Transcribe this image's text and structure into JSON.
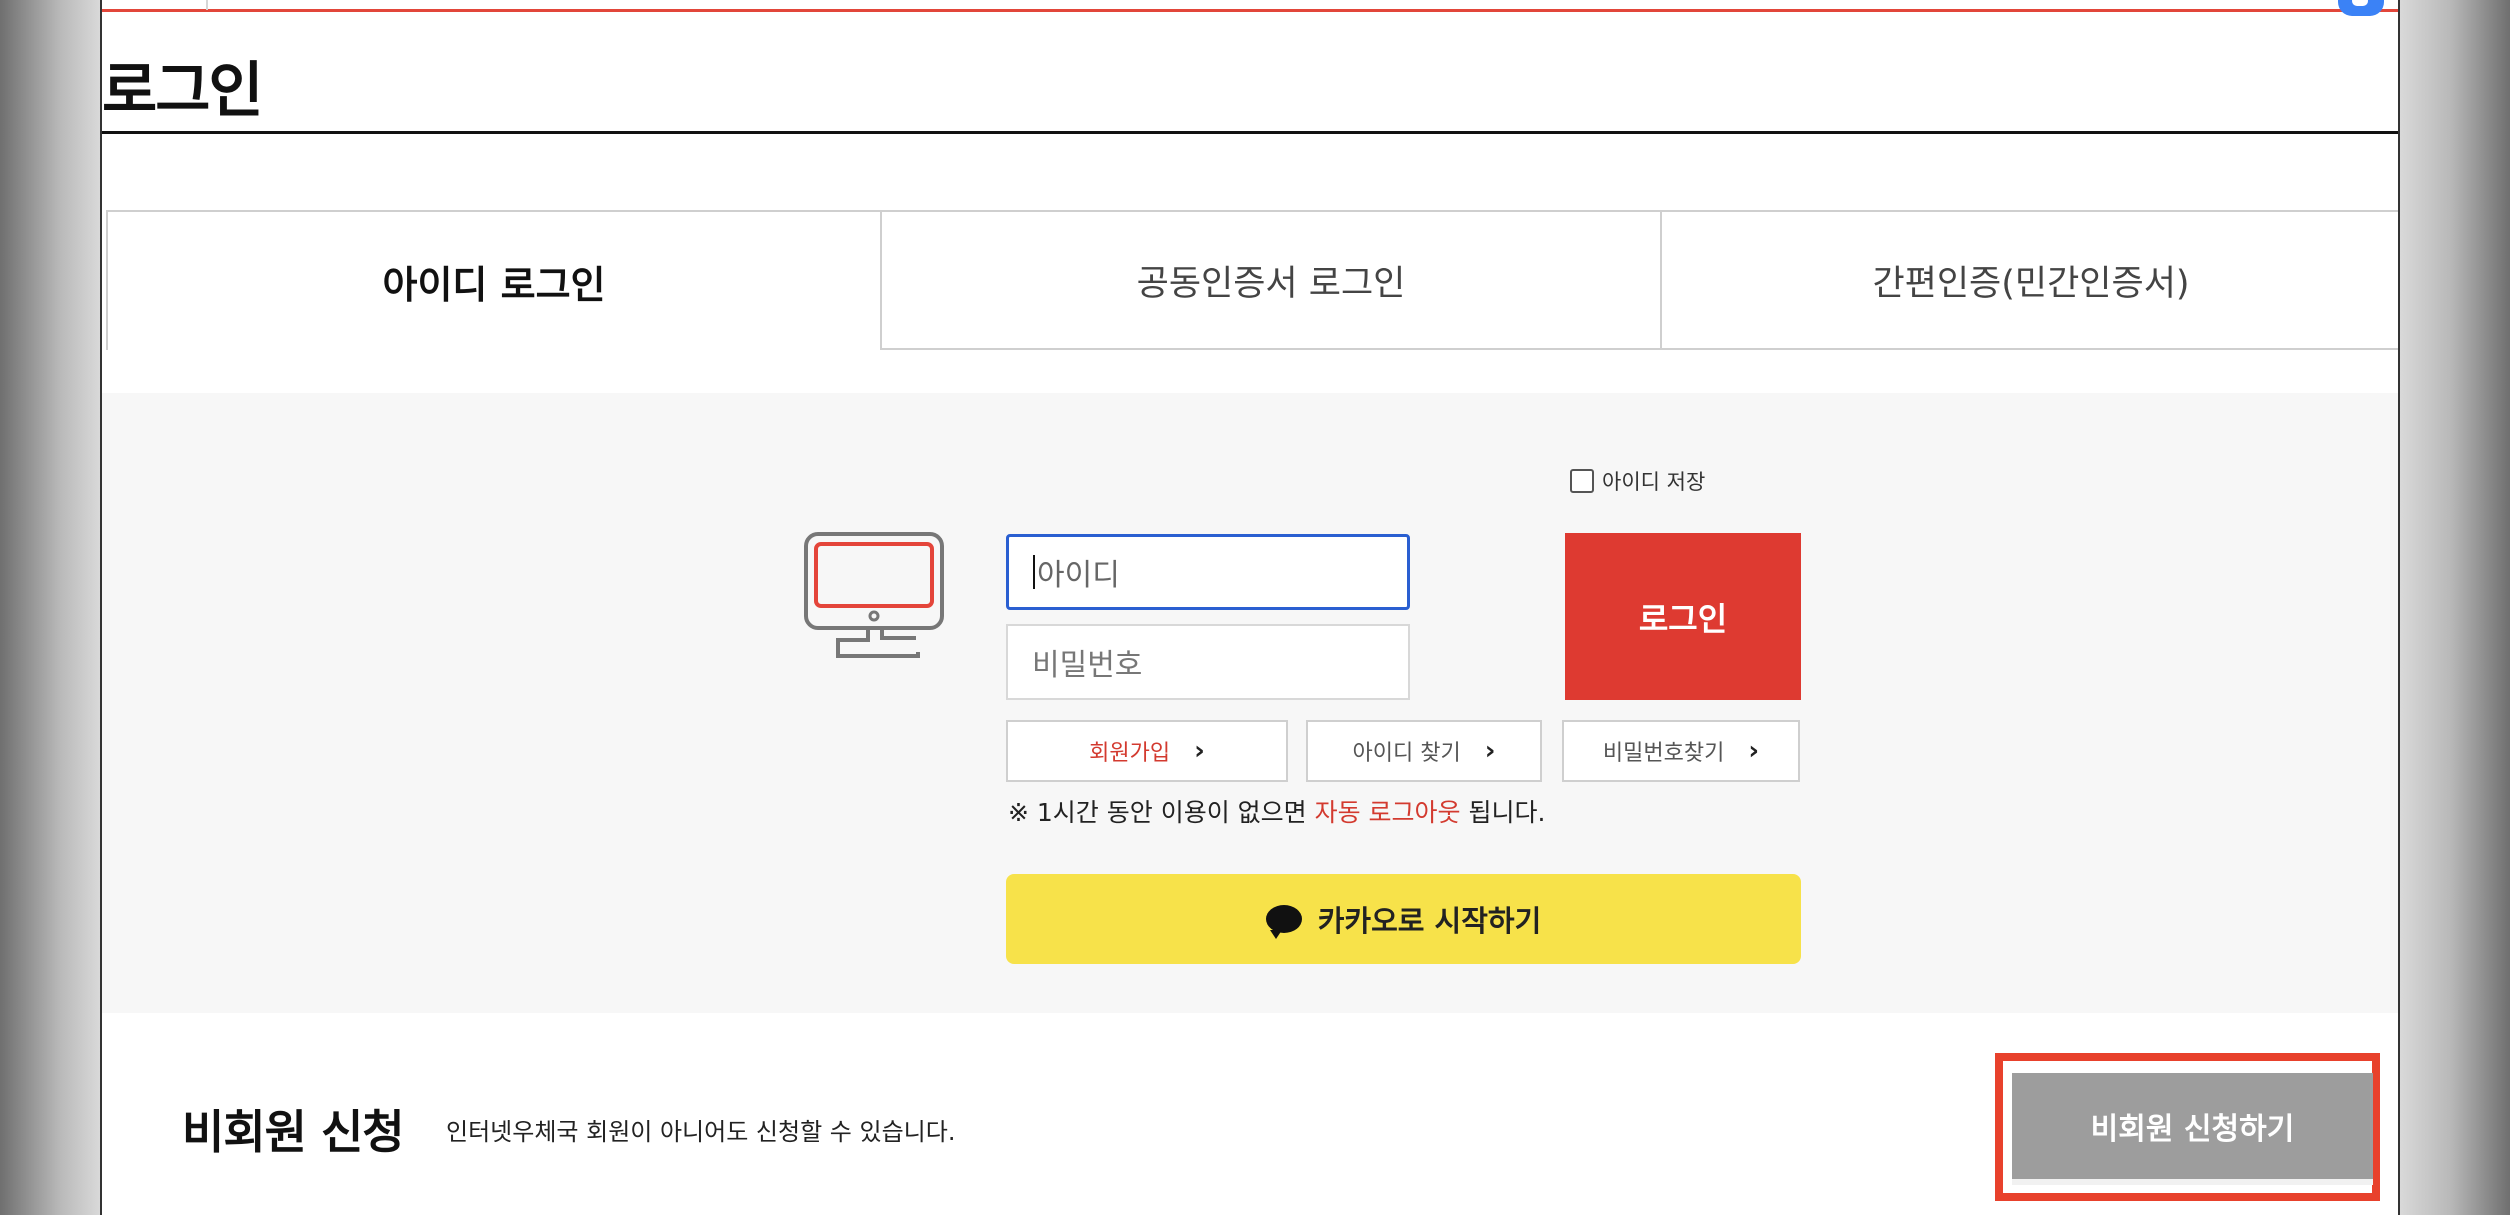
{
  "page": {
    "title": "로그인"
  },
  "tabs": [
    {
      "label": "아이디 로그인",
      "active": true
    },
    {
      "label": "공동인증서 로그인",
      "active": false
    },
    {
      "label": "간편인증(민간인증서)",
      "active": false
    }
  ],
  "login": {
    "remember_label": "아이디 저장",
    "id_placeholder": "아이디",
    "pw_placeholder": "비밀번호",
    "login_button": "로그인",
    "join_label": "회원가입",
    "find_id_label": "아이디 찾기",
    "find_pw_label": "비밀번호찾기",
    "notice_prefix": "※ 1시간 동안 이용이 없으면 ",
    "notice_highlight": "자동 로그아웃",
    "notice_suffix": " 됩니다.",
    "kakao_label": "카카오로 시작하기"
  },
  "guest": {
    "title": "비회원 신청",
    "description": "인터넷우체국 회원이 아니어도 신청할 수 있습니다.",
    "button_label": "비회원 신청하기"
  },
  "colors": {
    "accent_red": "#de3a31",
    "kakao_yellow": "#f7e24a",
    "focus_blue": "#2a5fd1",
    "guest_gray": "#9d9d9d",
    "highlight_frame": "#e8412c"
  },
  "icons": [
    "monitor-icon",
    "chevron-right-icon",
    "kakao-speech-bubble-icon",
    "checkbox-icon",
    "chat-icon"
  ]
}
